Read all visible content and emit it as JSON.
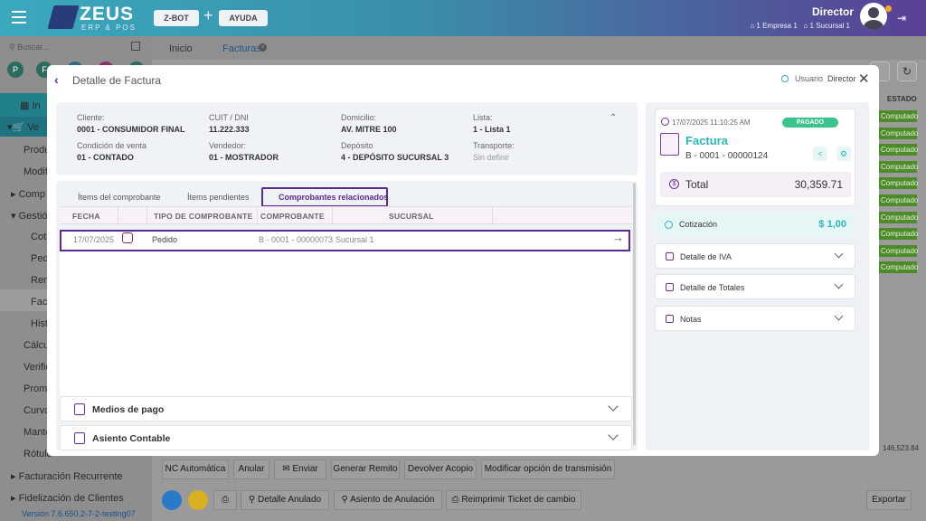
{
  "topbar": {
    "logo_title": "ZEUS",
    "logo_sub": "ERP & POS",
    "zbot": "Z-BOT",
    "ayuda": "AYUDA",
    "plus": "+",
    "user_name": "Director",
    "empresa": "1 Empresa 1",
    "sucursal": "1 Sucursal 1"
  },
  "sidebar": {
    "search_placeholder": "Buscar...",
    "circles": [
      "P",
      "F",
      "",
      "",
      ""
    ],
    "items": [
      {
        "label": "In"
      },
      {
        "label": "Ve"
      },
      {
        "label": "Produ"
      },
      {
        "label": "Modifi"
      },
      {
        "label": "Comp"
      },
      {
        "label": "Gestió"
      },
      {
        "label": "Coti"
      },
      {
        "label": "Pedi"
      },
      {
        "label": "Rem"
      },
      {
        "label": "Fact"
      },
      {
        "label": "Histo"
      },
      {
        "label": "Cálcu"
      },
      {
        "label": "Verific"
      },
      {
        "label": "Prome"
      },
      {
        "label": "Curva"
      },
      {
        "label": "Mante"
      },
      {
        "label": "Rótulo"
      },
      {
        "label": "Facturación Recurrente"
      },
      {
        "label": "Fidelización de Clientes"
      }
    ],
    "version": "Versión 7.6.650.2-7-2-testing07"
  },
  "tabs": {
    "inicio": "Inicio",
    "facturas": "Facturas"
  },
  "background": {
    "estado_header": "ESTADO",
    "computado": "Computado",
    "rows": 10,
    "partial_total": "146,523.84",
    "actions_row1": [
      "NC Automática",
      "Anular",
      "Enviar",
      "Generar Remito",
      "Devolver Acopio",
      "Modificar opción de transmisión"
    ],
    "actions_row2": [
      "Detalle Anulado",
      "Asiento de Anulación",
      "Reimprimir Ticket de cambio"
    ],
    "exportar": "Exportar"
  },
  "modal": {
    "title": "Detalle de Factura",
    "usuario_label": "Usuario",
    "usuario_value": "Director",
    "info": {
      "cliente_label": "Cliente:",
      "cliente_value": "0001 - CONSUMIDOR FINAL",
      "cuit_label": "CUIT / DNI",
      "cuit_value": "11.222.333",
      "domicilio_label": "Domicilio:",
      "domicilio_value": "AV. MITRE 100",
      "lista_label": "Lista:",
      "lista_value": "1 - Lista 1",
      "condicion_label": "Condición de venta",
      "condicion_value": "01 - CONTADO",
      "vendedor_label": "Vendedor:",
      "vendedor_value": "01 - MOSTRADOR",
      "deposito_label": "Depósito",
      "deposito_value": "4 - DEPÓSITO SUCURSAL 3",
      "transporte_label": "Transporte:",
      "transporte_value": "Sin definir"
    },
    "tabs": [
      "Ítems del comprobante",
      "Ítems pendientes",
      "Comprobantes relacionados"
    ],
    "table": {
      "headers": [
        "FECHA",
        "TIPO DE COMPROBANTE",
        "COMPROBANTE",
        "SUCURSAL"
      ],
      "rows": [
        {
          "fecha": "17/07/2025",
          "tipo": "Pedido",
          "comprobante": "B - 0001 - 00000073",
          "sucursal": "Sucursal 1"
        }
      ]
    },
    "accordions": [
      "Medios de pago",
      "Asiento Contable"
    ],
    "right": {
      "datetime": "17/07/2025 11:10:25 AM",
      "status": "PAGADO",
      "doc_type": "Factura",
      "doc_number": "B - 0001 - 00000124",
      "total_label": "Total",
      "total_value": "30,359.71",
      "cotizacion_label": "Cotización",
      "cotizacion_value": "$ 1,00",
      "sections": [
        "Detalle de IVA",
        "Detalle de Totales",
        "Notas"
      ]
    }
  },
  "colors": {
    "accent_purple": "#5a2a96",
    "accent_teal": "#2cb5b8",
    "status_green": "#3bc48d"
  }
}
